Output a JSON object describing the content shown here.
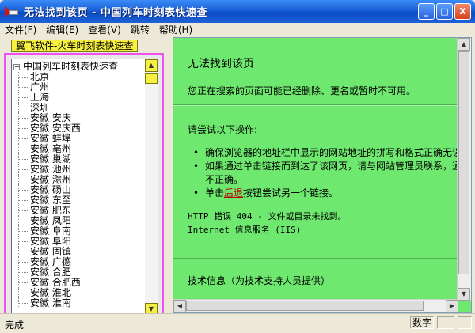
{
  "window": {
    "title": "无法找到该页 - 中国列车时刻表快速查",
    "buttons": {
      "minimize": "_",
      "maximize": "□",
      "close": "X"
    }
  },
  "menu": [
    "文件(F)",
    "编辑(E)",
    "查看(V)",
    "跳转",
    "帮助(H)"
  ],
  "left": {
    "tab_label": "翼飞软件-火车时刻表快速查",
    "tree_root": "中国列车时刻表快速查",
    "tree_items": [
      "北京",
      "广州",
      "上海",
      "深圳",
      "安徽 安庆",
      "安徽 安庆西",
      "安徽 蚌埠",
      "安徽 亳州",
      "安徽 巢湖",
      "安徽 池州",
      "安徽 滁州",
      "安徽 砀山",
      "安徽 东至",
      "安徽 肥东",
      "安徽 凤阳",
      "安徽 阜南",
      "安徽 阜阳",
      "安徽 固镇",
      "安徽 广德",
      "安徽 合肥",
      "安徽 合肥西",
      "安徽 淮北",
      "安徽 淮南"
    ]
  },
  "content": {
    "heading": "无法找到该页",
    "intro": "您正在搜索的页面可能已经删除、更名或暂时不可用。",
    "try_heading": "请尝试以下操作:",
    "bullet1": "确保浏览器的地址栏中显示的网站地址的拼写和格式正确无误。",
    "bullet2_line1": "如果通过单击链接而到达了该网页，请与网站管理员联系，通知他们该链接的格式",
    "bullet2_line2": "不正确。",
    "bullet3_prefix": "单击",
    "bullet3_link": "后退",
    "bullet3_suffix": "按钮尝试另一个链接。",
    "error_line": "HTTP 错误 404 - 文件或目录未找到。",
    "server_line": "Internet 信息服务 (IIS)",
    "tech_heading": "技术信息（为技术支持人员提供）"
  },
  "status": {
    "text": "完成",
    "panel": "数字"
  }
}
